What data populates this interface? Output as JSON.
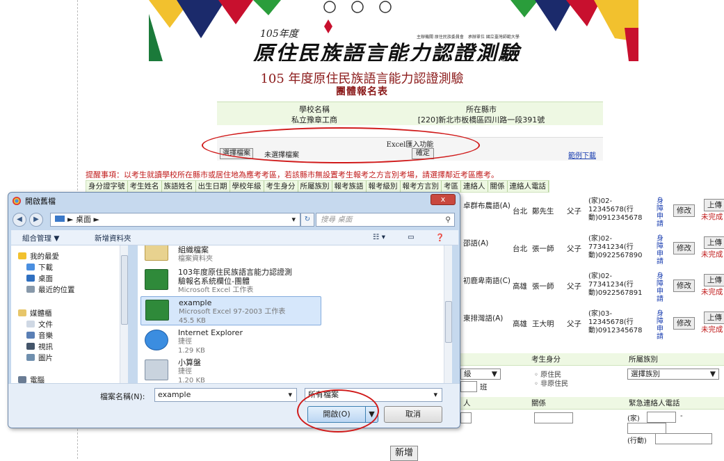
{
  "banner": {
    "year": "105年度",
    "org_text": "主辦機關 原住民族委員會　承辦單位 國立臺灣師範大學",
    "title": "原住民族語言能力認證測驗"
  },
  "page": {
    "title": "105 年度原住民族語言能力認證測驗",
    "subtitle": "團體報名表"
  },
  "school": {
    "name_header": "學校名稱",
    "name_value": "私立豫章工商",
    "city_header": "所在縣市",
    "city_value": "[220]新北市板橋區四川路一段391號"
  },
  "excel": {
    "title": "Excel匯入功能",
    "choose_file": "選擇檔案",
    "no_file": "未選擇檔案",
    "confirm": "確定",
    "sample_download": "範例下載"
  },
  "reminder": "提醒事項：以考生就讀學校所在縣市或居住地為應考考區，若該縣市無設置考生報考之方言別考場，請選擇鄰近考區應考。",
  "table": {
    "headers": [
      "身分證字號",
      "考生姓名",
      "族語姓名",
      "出生日期",
      "學校年級",
      "考生身分",
      "所屬族別",
      "報考族語",
      "報考級別",
      "報考方言別",
      "考區",
      "連絡人",
      "關係",
      "連絡人電話"
    ],
    "rows": [
      {
        "dialect": "卓群布農語(A)",
        "area": "台北",
        "contact": "鄭先生",
        "relation": "父子",
        "phone": "(家)02-12345678(行動)0912345678",
        "status": "身障申請",
        "edit": "修改",
        "upload": "上傳",
        "upload_status": "未完成"
      },
      {
        "dialect": "邵語(A)",
        "area": "台北",
        "contact": "張一師",
        "relation": "父子",
        "phone": "(家)02-77341234(行動)0922567890",
        "status": "身障申請",
        "edit": "修改",
        "upload": "上傳",
        "upload_status": "未完成"
      },
      {
        "dialect": "初鹿卑南語(C)",
        "area": "高雄",
        "contact": "張一師",
        "relation": "父子",
        "phone": "(家)02-77341234(行動)0922567891",
        "status": "身障申請",
        "edit": "修改",
        "upload": "上傳",
        "upload_status": "未完成"
      },
      {
        "dialect": "東排灣語(A)",
        "area": "高雄",
        "contact": "王大明",
        "relation": "父子",
        "phone": "(家)03-12345678(行動)0912345678",
        "status": "身障申請",
        "edit": "修改",
        "upload": "上傳",
        "upload_status": "未完成"
      }
    ]
  },
  "lower_form": {
    "grade_select": "級",
    "class_suffix": "班",
    "identity_header": "考生身分",
    "identity_options": [
      "原住民",
      "非原住民"
    ],
    "tribe_header": "所屬族別",
    "tribe_select": "選擇族別",
    "contact_header": "人",
    "relation_header": "關係",
    "emergency_header": "緊急連絡人電話",
    "home_label": "(家)",
    "dash": "-",
    "mobile_label": "(行動)",
    "add_button": "新增"
  },
  "dialog": {
    "title": "開啟舊檔",
    "close": "x",
    "address": "桌面",
    "search_placeholder": "搜尋 桌面",
    "organize": "組合管理 ▼",
    "new_folder": "新增資料夾",
    "nav_items": [
      "我的最愛",
      "下載",
      "桌面",
      "最近的位置",
      "媒體櫃",
      "文件",
      "音樂",
      "視訊",
      "圖片",
      "電腦"
    ],
    "files": [
      {
        "name": "組織檔案",
        "line2": "檔案資料夾",
        "line3": ""
      },
      {
        "name": "103年度原住民族語言能力認證測",
        "line2": "驗報名系統欄位-團體",
        "line3": "Microsoft Excel 工作表"
      },
      {
        "name": "example",
        "line2": "Microsoft Excel 97-2003 工作表",
        "line3": "45.5 KB"
      },
      {
        "name": "Internet Explorer",
        "line2": "捷徑",
        "line3": "1.29 KB"
      },
      {
        "name": "小算盤",
        "line2": "捷徑",
        "line3": "1.20 KB"
      }
    ],
    "filename_label": "檔案名稱(N):",
    "filename_value": "example",
    "filetype_value": "所有檔案",
    "open_button": "開啟(O)",
    "cancel_button": "取消"
  },
  "colors": {
    "accent_red": "#d01a1a",
    "title_red": "#8b1a1a",
    "table_green": "#eef8e3",
    "link_blue": "#1b3fb0"
  }
}
